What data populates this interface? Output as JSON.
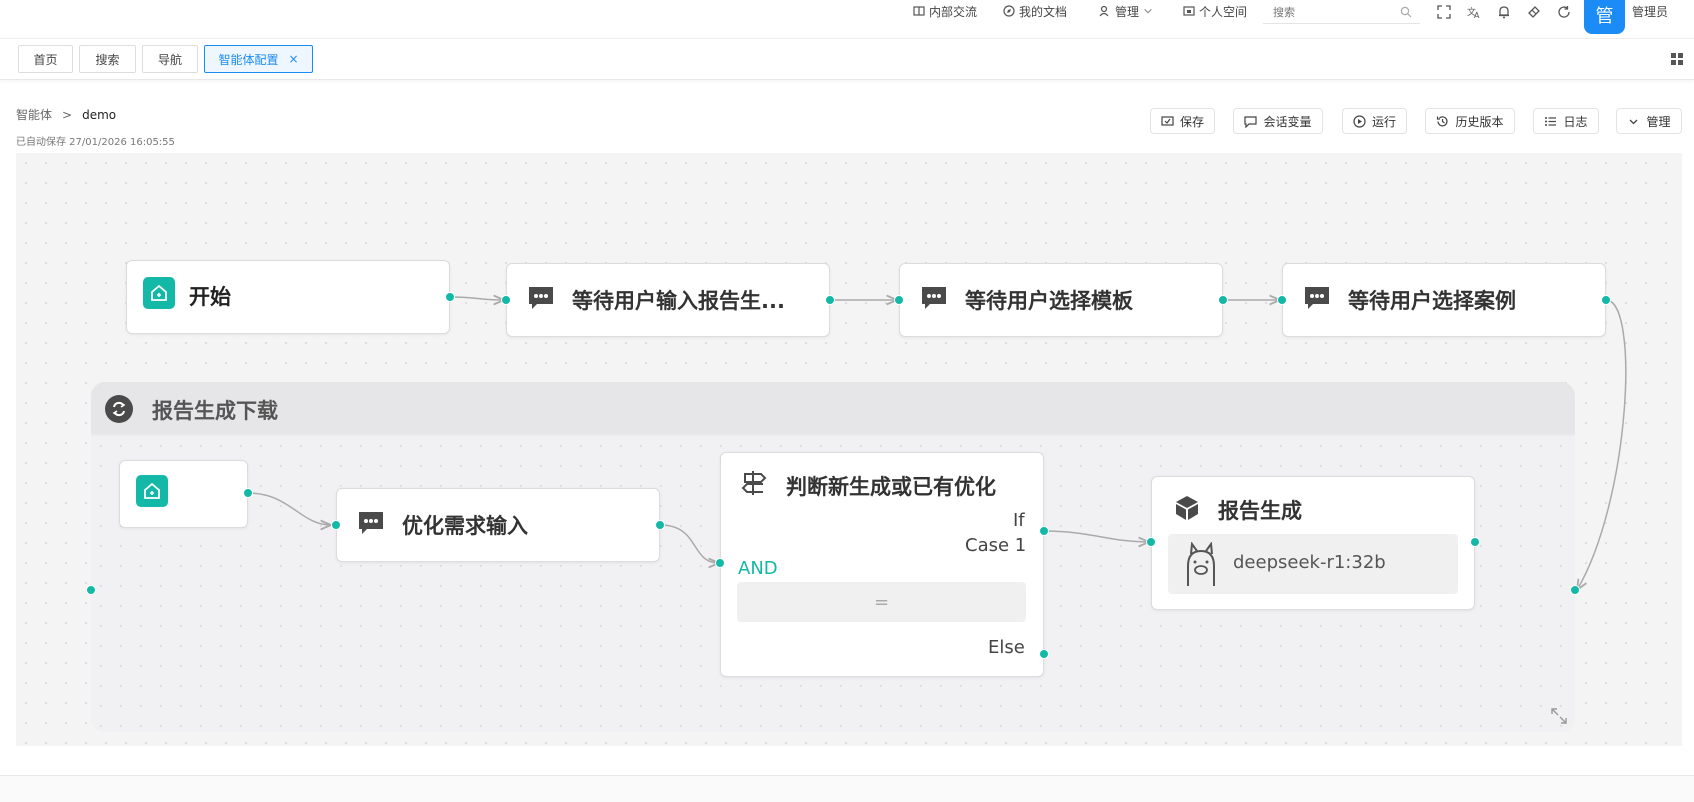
{
  "topbar": {
    "links": {
      "internal_exchange": "内部交流",
      "my_docs": "我的文档",
      "manage": "管理",
      "personal_space": "个人空间"
    },
    "search_placeholder": "搜索",
    "avatar_char": "管",
    "user_name": "管理员"
  },
  "tabs": {
    "home": "首页",
    "search": "搜索",
    "nav": "导航",
    "agent_config": "智能体配置",
    "close_glyph": "×"
  },
  "breadcrumb": {
    "parent": "智能体",
    "separator": ">",
    "current": "demo"
  },
  "autosave": "已自动保存 27/01/2026 16:05:55",
  "actions": {
    "save": "保存",
    "session_vars": "会话变量",
    "run": "运行",
    "history": "历史版本",
    "log": "日志",
    "manage": "管理"
  },
  "flow": {
    "start": {
      "title": "开始"
    },
    "wait_report": {
      "title": "等待用户输入报告生..."
    },
    "wait_template": {
      "title": "等待用户选择模板"
    },
    "wait_case": {
      "title": "等待用户选择案例"
    },
    "loop": {
      "title": "报告生成下载"
    },
    "optimize": {
      "title": "优化需求输入"
    },
    "condition": {
      "title": "判断新生成或已有优化",
      "if_label": "If",
      "case_label": "Case 1",
      "and_label": "AND",
      "operator": "=",
      "else_label": "Else"
    },
    "report": {
      "title": "报告生成",
      "model": "deepseek-r1:32b"
    }
  },
  "colors": {
    "accent": "#14b8a6",
    "primary": "#1b8cf5"
  }
}
